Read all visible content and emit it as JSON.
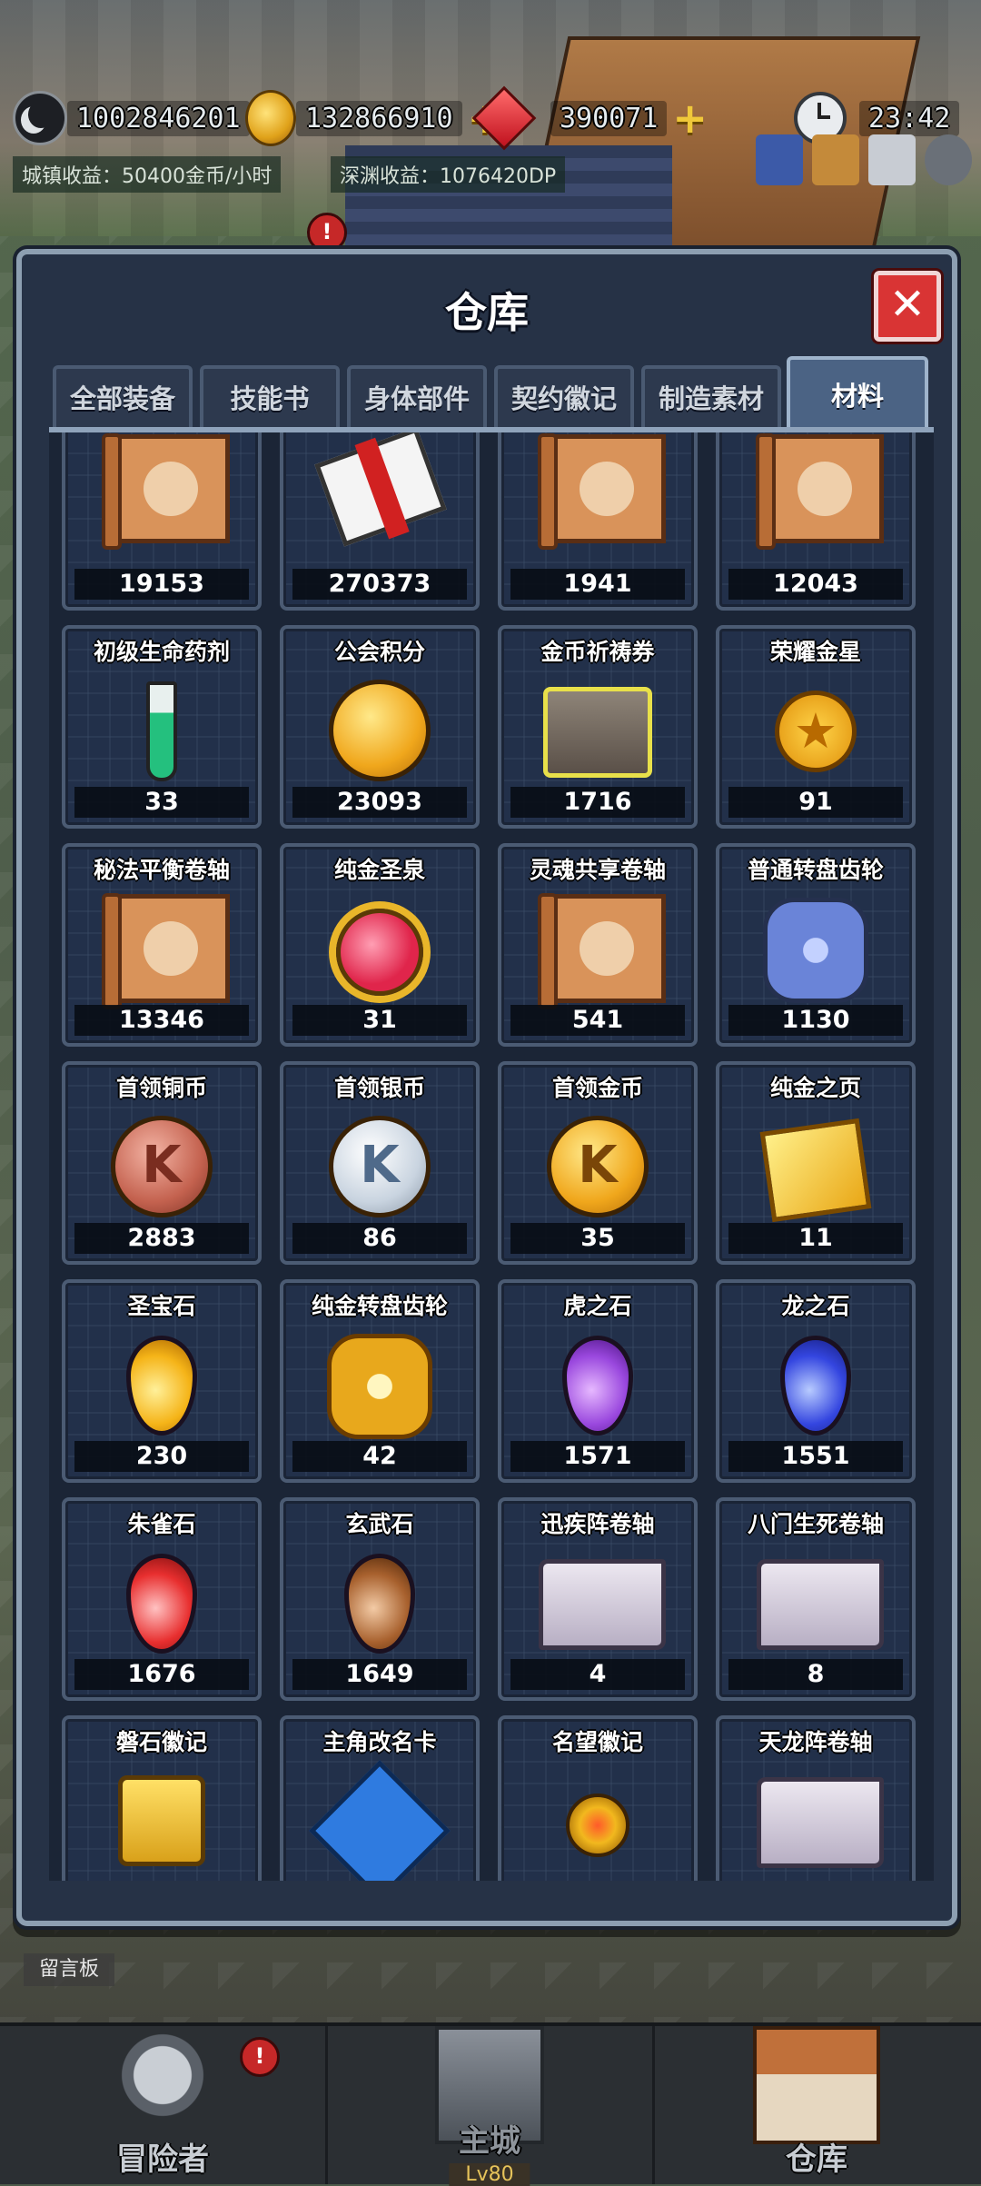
{
  "resources": {
    "moon_value": "1002846201",
    "gold_value": "132866910",
    "gem_value": "390071",
    "time": "23:42"
  },
  "income": {
    "town": "城镇收益：50400金币/小时",
    "abyss": "深渊收益：1076420DP"
  },
  "alert_mark": "!",
  "panel": {
    "title": "仓库",
    "close_glyph": "✕",
    "tabs": [
      {
        "label": "全部装备"
      },
      {
        "label": "技能书"
      },
      {
        "label": "身体部件"
      },
      {
        "label": "契约徽记"
      },
      {
        "label": "制造素材"
      },
      {
        "label": "材料"
      }
    ],
    "active_tab": "材料"
  },
  "items": [
    {
      "name": "",
      "count": "19153",
      "icon": "scroll-icon"
    },
    {
      "name": "",
      "count": "270373",
      "icon": "envelope-icon"
    },
    {
      "name": "",
      "count": "1941",
      "icon": "scroll-icon"
    },
    {
      "name": "",
      "count": "12043",
      "icon": "scroll-icon"
    },
    {
      "name": "初级生命药剂",
      "count": "33",
      "icon": "vial-icon"
    },
    {
      "name": "公会积分",
      "count": "23093",
      "icon": "coin-icon"
    },
    {
      "name": "金币祈祷券",
      "count": "1716",
      "icon": "ticket-icon"
    },
    {
      "name": "荣耀金星",
      "count": "91",
      "icon": "star-coin-icon"
    },
    {
      "name": "秘法平衡卷轴",
      "count": "13346",
      "icon": "scroll-icon"
    },
    {
      "name": "纯金圣泉",
      "count": "31",
      "icon": "potion-icon"
    },
    {
      "name": "灵魂共享卷轴",
      "count": "541",
      "icon": "scroll-icon"
    },
    {
      "name": "普通转盘齿轮",
      "count": "1130",
      "icon": "gear-icon"
    },
    {
      "name": "首领铜币",
      "count": "2883",
      "icon": "coin-icon"
    },
    {
      "name": "首领银币",
      "count": "86",
      "icon": "coin-icon"
    },
    {
      "name": "首领金币",
      "count": "35",
      "icon": "coin-icon"
    },
    {
      "name": "纯金之页",
      "count": "11",
      "icon": "golden-page-icon"
    },
    {
      "name": "圣宝石",
      "count": "230",
      "icon": "gem-icon"
    },
    {
      "name": "纯金转盘齿轮",
      "count": "42",
      "icon": "gear-icon"
    },
    {
      "name": "虎之石",
      "count": "1571",
      "icon": "gem-icon"
    },
    {
      "name": "龙之石",
      "count": "1551",
      "icon": "gem-icon"
    },
    {
      "name": "朱雀石",
      "count": "1676",
      "icon": "gem-icon"
    },
    {
      "name": "玄武石",
      "count": "1649",
      "icon": "gem-icon"
    },
    {
      "name": "迅疾阵卷轴",
      "count": "4",
      "icon": "paper-scroll-icon"
    },
    {
      "name": "八门生死卷轴",
      "count": "8",
      "icon": "paper-scroll-icon"
    },
    {
      "name": "磐石徽记",
      "count": "",
      "icon": "emblem-icon"
    },
    {
      "name": "主角改名卡",
      "count": "",
      "icon": "rename-card-icon"
    },
    {
      "name": "名望徽记",
      "count": "",
      "icon": "medal-icon"
    },
    {
      "name": "天龙阵卷轴",
      "count": "",
      "icon": "paper-scroll-icon"
    }
  ],
  "coin_letter": "K",
  "star_glyph": "★",
  "message_board": "留言板",
  "nav": [
    {
      "label": "冒险者"
    },
    {
      "label": "主城",
      "level": "Lv80"
    },
    {
      "label": "仓库"
    }
  ],
  "colors": {
    "panel_bg": "#263246",
    "panel_border": "#8d9fb1",
    "active_tab": "#4b6384",
    "close_red": "#d93434"
  }
}
